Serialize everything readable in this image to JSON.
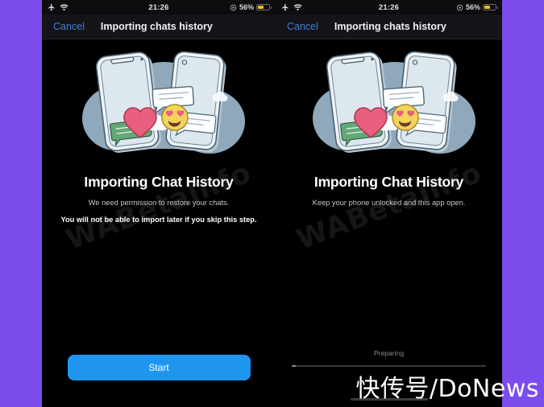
{
  "watermarks": {
    "diagonal": "WABetaInfo",
    "brand": "快传号/DoNews"
  },
  "colors": {
    "page_background": "#7b4cec",
    "screen_background": "#000000",
    "navbar_background": "#141419",
    "accent_blue": "#1e96f0",
    "cancel_blue": "#3f7fd4",
    "battery_yellow": "#f0c400",
    "illustration_blob": "#8fa8bb",
    "heart_pink": "#e8607d",
    "emoji_yellow": "#f2d45c",
    "bubble_green": "#63a877"
  },
  "screens": [
    {
      "id": "permission-screen",
      "status_bar": {
        "airplane_icon": "airplane-mode-icon",
        "wifi_icon": "wifi-icon",
        "time": "21:26",
        "lowpower_icon": "low-power-icon",
        "battery_percent": "56%",
        "battery_level": 56,
        "battery_icon": "battery-icon"
      },
      "nav_bar": {
        "cancel_label": "Cancel",
        "title": "Importing chats history"
      },
      "illustration": "two-phones-chat-transfer-illustration",
      "title": "Importing Chat History",
      "subtitle": "We need permission to restore your chats.",
      "warning": "You will not be able to import later if you skip this step.",
      "primary_button": "Start"
    },
    {
      "id": "progress-screen",
      "status_bar": {
        "airplane_icon": "airplane-mode-icon",
        "wifi_icon": "wifi-icon",
        "time": "21:26",
        "lowpower_icon": "low-power-icon",
        "battery_percent": "56%",
        "battery_level": 56,
        "battery_icon": "battery-icon"
      },
      "nav_bar": {
        "cancel_label": "Cancel",
        "title": "Importing chats history"
      },
      "illustration": "two-phones-chat-transfer-illustration",
      "title": "Importing Chat History",
      "subtitle": "Keep your phone unlocked and this app open.",
      "progress_label": "Preparing",
      "progress_percent": 2
    }
  ]
}
